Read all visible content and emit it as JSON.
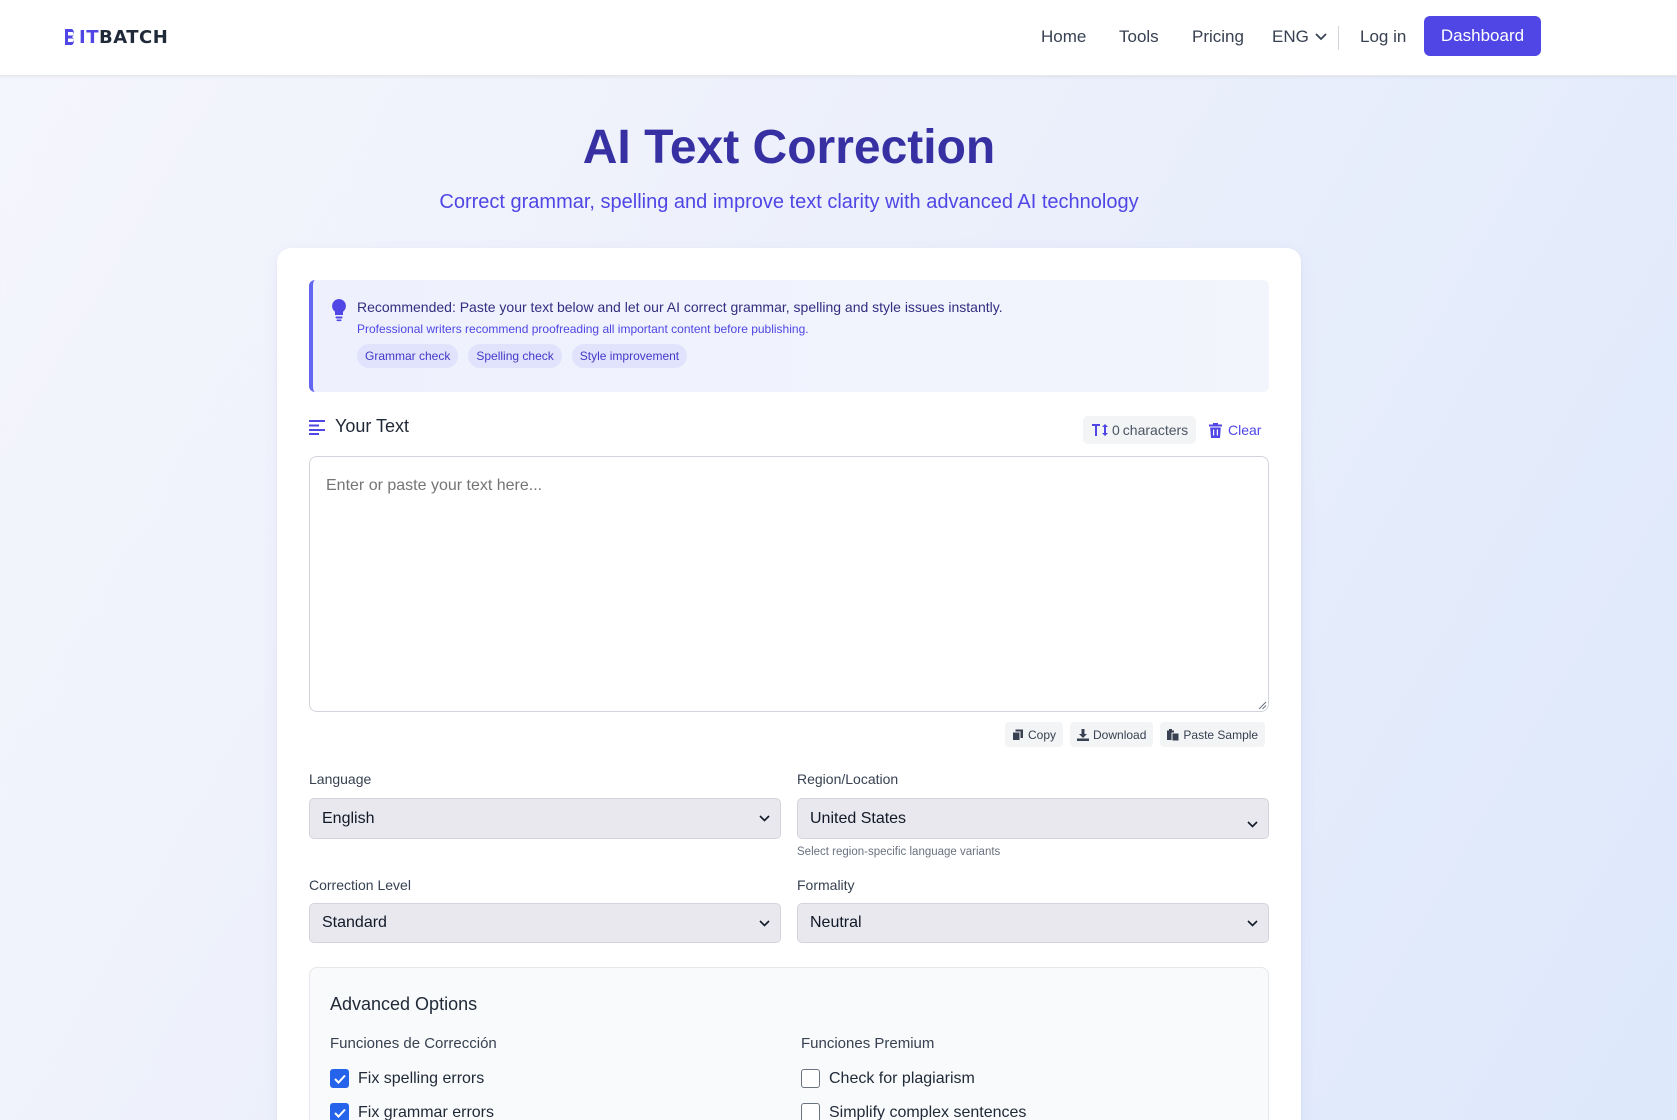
{
  "header": {
    "logo_it": "IT",
    "logo_rest": "BATCH",
    "nav": {
      "home": "Home",
      "tools": "Tools",
      "pricing": "Pricing",
      "language": "ENG",
      "login": "Log in",
      "dashboard": "Dashboard"
    }
  },
  "hero": {
    "title": "AI Text Correction",
    "subtitle": "Correct grammar, spelling and improve text clarity with advanced AI technology"
  },
  "tip": {
    "main": "Recommended: Paste your text below and let our AI correct grammar, spelling and style issues instantly.",
    "sub": "Professional writers recommend proofreading all important content before publishing.",
    "tags": [
      "Grammar check",
      "Spelling check",
      "Style improvement"
    ]
  },
  "editor": {
    "title": "Your Text",
    "char_count": "0",
    "char_label": "characters",
    "clear": "Clear",
    "placeholder": "Enter or paste your text here...",
    "value": "",
    "copy": "Copy",
    "download": "Download",
    "paste_sample": "Paste Sample"
  },
  "settings": {
    "language_label": "Language",
    "language_value": "English",
    "region_label": "Region/Location",
    "region_value": "United States",
    "region_hint": "Select region-specific language variants",
    "level_label": "Correction Level",
    "level_value": "Standard",
    "formality_label": "Formality",
    "formality_value": "Neutral"
  },
  "advanced": {
    "title": "Advanced Options",
    "col1_title": "Funciones de Corrección",
    "col2_title": "Funciones Premium",
    "col1": [
      {
        "label": "Fix spelling errors",
        "checked": true
      },
      {
        "label": "Fix grammar errors",
        "checked": true
      }
    ],
    "col2": [
      {
        "label": "Check for plagiarism",
        "checked": false
      },
      {
        "label": "Simplify complex sentences",
        "checked": false
      }
    ]
  },
  "colors": {
    "brand": "#4f46e5",
    "title": "#3730a3",
    "checkbox": "#2563eb"
  }
}
